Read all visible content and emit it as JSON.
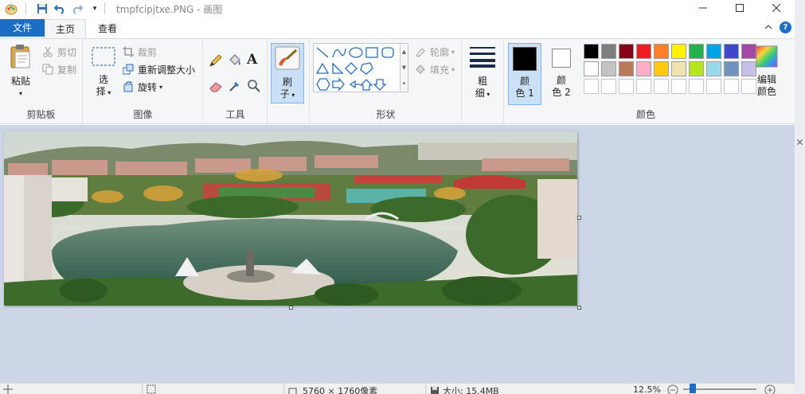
{
  "window": {
    "title": "tmpfcipjtxe.PNG - 画图"
  },
  "tabs": {
    "file": "文件",
    "home": "主页",
    "view": "查看"
  },
  "clipboard": {
    "paste": "粘贴",
    "cut": "剪切",
    "copy": "复制",
    "label": "剪贴板"
  },
  "image_group": {
    "select_1": "选",
    "select_2": "择",
    "crop": "裁剪",
    "resize": "重新调整大小",
    "rotate": "旋转",
    "label": "图像"
  },
  "tools": {
    "label": "工具",
    "text_tool": "A"
  },
  "brushes": {
    "label_1": "刷",
    "label_2": "子"
  },
  "shapes": {
    "outline": "轮廓",
    "fill": "填充",
    "label": "形状"
  },
  "size": {
    "label_1": "粗",
    "label_2": "细"
  },
  "colors": {
    "color1_1": "颜",
    "color1_2": "色 1",
    "color2_1": "颜",
    "color2_2": "色 2",
    "edit_1": "编辑",
    "edit_2": "颜色",
    "label": "颜色",
    "color1_value": "#000000",
    "color2_value": "#ffffff",
    "palette_row1": [
      "#000000",
      "#7f7f7f",
      "#880015",
      "#ed1c24",
      "#ff7f27",
      "#fff200",
      "#22b14c",
      "#00a2e8",
      "#3f48cc",
      "#a349a4"
    ],
    "palette_row2": [
      "#ffffff",
      "#c3c3c3",
      "#b97a57",
      "#ffaec9",
      "#ffc90e",
      "#efe4b0",
      "#b5e61d",
      "#99d9ea",
      "#7092be",
      "#c8bfe7"
    ]
  },
  "status": {
    "dimensions": "5760 × 1760像素",
    "file_size": "大小: 15.4MB",
    "zoom": "12.5%"
  }
}
